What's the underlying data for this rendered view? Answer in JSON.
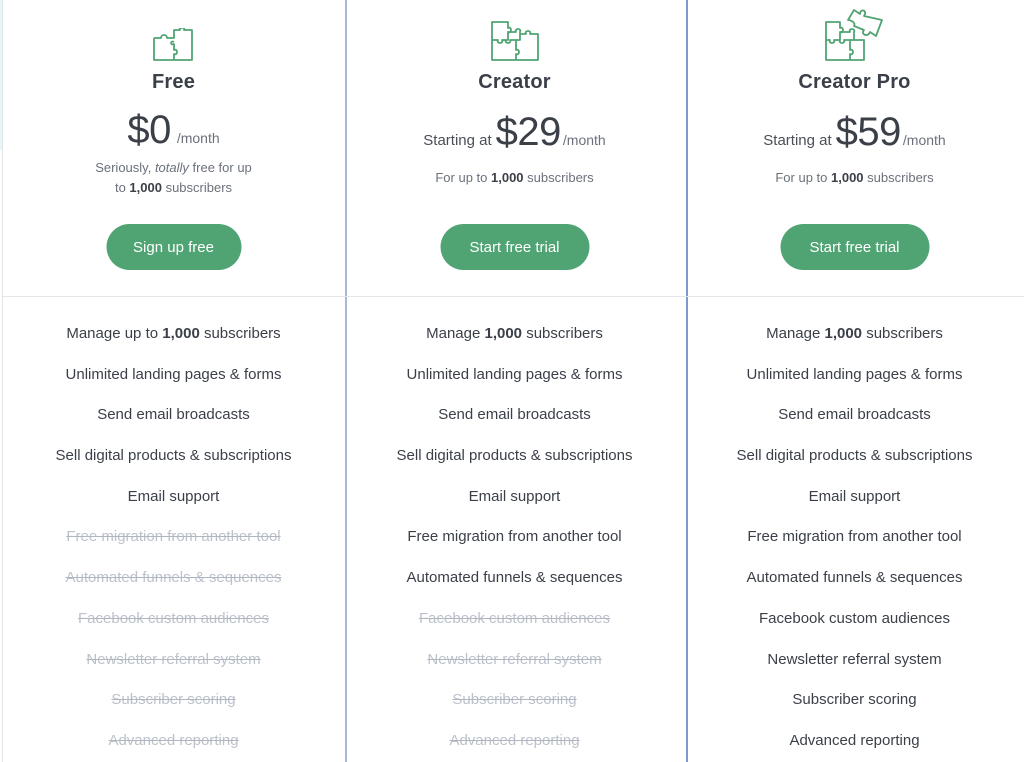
{
  "theme": {
    "accent": "#50a473",
    "divider": "#a9b8d8",
    "text": "#3a3f48",
    "muted": "#6b717b",
    "disabled": "#bcc2cc"
  },
  "plans": [
    {
      "icon": "single-puzzle-icon",
      "name": "Free",
      "price_prefix": "",
      "price_amount": "$0",
      "price_unit": "/month",
      "description": {
        "line1_pre": "Seriously, ",
        "line1_em": "totally",
        "line1_post": " free for up",
        "line2_pre": "to ",
        "line2_bold": "1,000",
        "line2_post": " subscribers"
      },
      "cta_label": "Sign up free",
      "features": [
        {
          "pre": "Manage up to ",
          "bold": "1,000",
          "post": " subscribers",
          "included": true
        },
        {
          "pre": "Unlimited landing pages & forms",
          "bold": "",
          "post": "",
          "included": true
        },
        {
          "pre": "Send email broadcasts",
          "bold": "",
          "post": "",
          "included": true
        },
        {
          "pre": "Sell digital products & subscriptions",
          "bold": "",
          "post": "",
          "included": true
        },
        {
          "pre": "Email support",
          "bold": "",
          "post": "",
          "included": true
        },
        {
          "pre": "Free migration from another tool",
          "bold": "",
          "post": "",
          "included": false
        },
        {
          "pre": "Automated funnels & sequences",
          "bold": "",
          "post": "",
          "included": false
        },
        {
          "pre": "Facebook custom audiences",
          "bold": "",
          "post": "",
          "included": false
        },
        {
          "pre": "Newsletter referral system",
          "bold": "",
          "post": "",
          "included": false
        },
        {
          "pre": "Subscriber scoring",
          "bold": "",
          "post": "",
          "included": false
        },
        {
          "pre": "Advanced reporting",
          "bold": "",
          "post": "",
          "included": false
        }
      ]
    },
    {
      "icon": "puzzle-pieces-icon",
      "name": "Creator",
      "price_prefix": "Starting at",
      "price_amount": "$29",
      "price_unit": "/month",
      "description": {
        "line1_pre": "For up to ",
        "line1_bold": "1,000",
        "line1_post": " subscribers"
      },
      "cta_label": "Start free trial",
      "features": [
        {
          "pre": "Manage ",
          "bold": "1,000",
          "post": " subscribers",
          "included": true
        },
        {
          "pre": "Unlimited landing pages & forms",
          "bold": "",
          "post": "",
          "included": true
        },
        {
          "pre": "Send email broadcasts",
          "bold": "",
          "post": "",
          "included": true
        },
        {
          "pre": "Sell digital products & subscriptions",
          "bold": "",
          "post": "",
          "included": true
        },
        {
          "pre": "Email support",
          "bold": "",
          "post": "",
          "included": true
        },
        {
          "pre": "Free migration from another tool",
          "bold": "",
          "post": "",
          "included": true
        },
        {
          "pre": "Automated funnels & sequences",
          "bold": "",
          "post": "",
          "included": true
        },
        {
          "pre": "Facebook custom audiences",
          "bold": "",
          "post": "",
          "included": false
        },
        {
          "pre": "Newsletter referral system",
          "bold": "",
          "post": "",
          "included": false
        },
        {
          "pre": "Subscriber scoring",
          "bold": "",
          "post": "",
          "included": false
        },
        {
          "pre": "Advanced reporting",
          "bold": "",
          "post": "",
          "included": false
        }
      ]
    },
    {
      "icon": "puzzle-cluster-icon",
      "name": "Creator Pro",
      "price_prefix": "Starting at",
      "price_amount": "$59",
      "price_unit": "/month",
      "description": {
        "line1_pre": "For up to ",
        "line1_bold": "1,000",
        "line1_post": " subscribers"
      },
      "cta_label": "Start free trial",
      "features": [
        {
          "pre": "Manage ",
          "bold": "1,000",
          "post": " subscribers",
          "included": true
        },
        {
          "pre": "Unlimited landing pages & forms",
          "bold": "",
          "post": "",
          "included": true
        },
        {
          "pre": "Send email broadcasts",
          "bold": "",
          "post": "",
          "included": true
        },
        {
          "pre": "Sell digital products & subscriptions",
          "bold": "",
          "post": "",
          "included": true
        },
        {
          "pre": "Email support",
          "bold": "",
          "post": "",
          "included": true
        },
        {
          "pre": "Free migration from another tool",
          "bold": "",
          "post": "",
          "included": true
        },
        {
          "pre": "Automated funnels & sequences",
          "bold": "",
          "post": "",
          "included": true
        },
        {
          "pre": "Facebook custom audiences",
          "bold": "",
          "post": "",
          "included": true
        },
        {
          "pre": "Newsletter referral system",
          "bold": "",
          "post": "",
          "included": true
        },
        {
          "pre": "Subscriber scoring",
          "bold": "",
          "post": "",
          "included": true
        },
        {
          "pre": "Advanced reporting",
          "bold": "",
          "post": "",
          "included": true
        }
      ]
    }
  ]
}
